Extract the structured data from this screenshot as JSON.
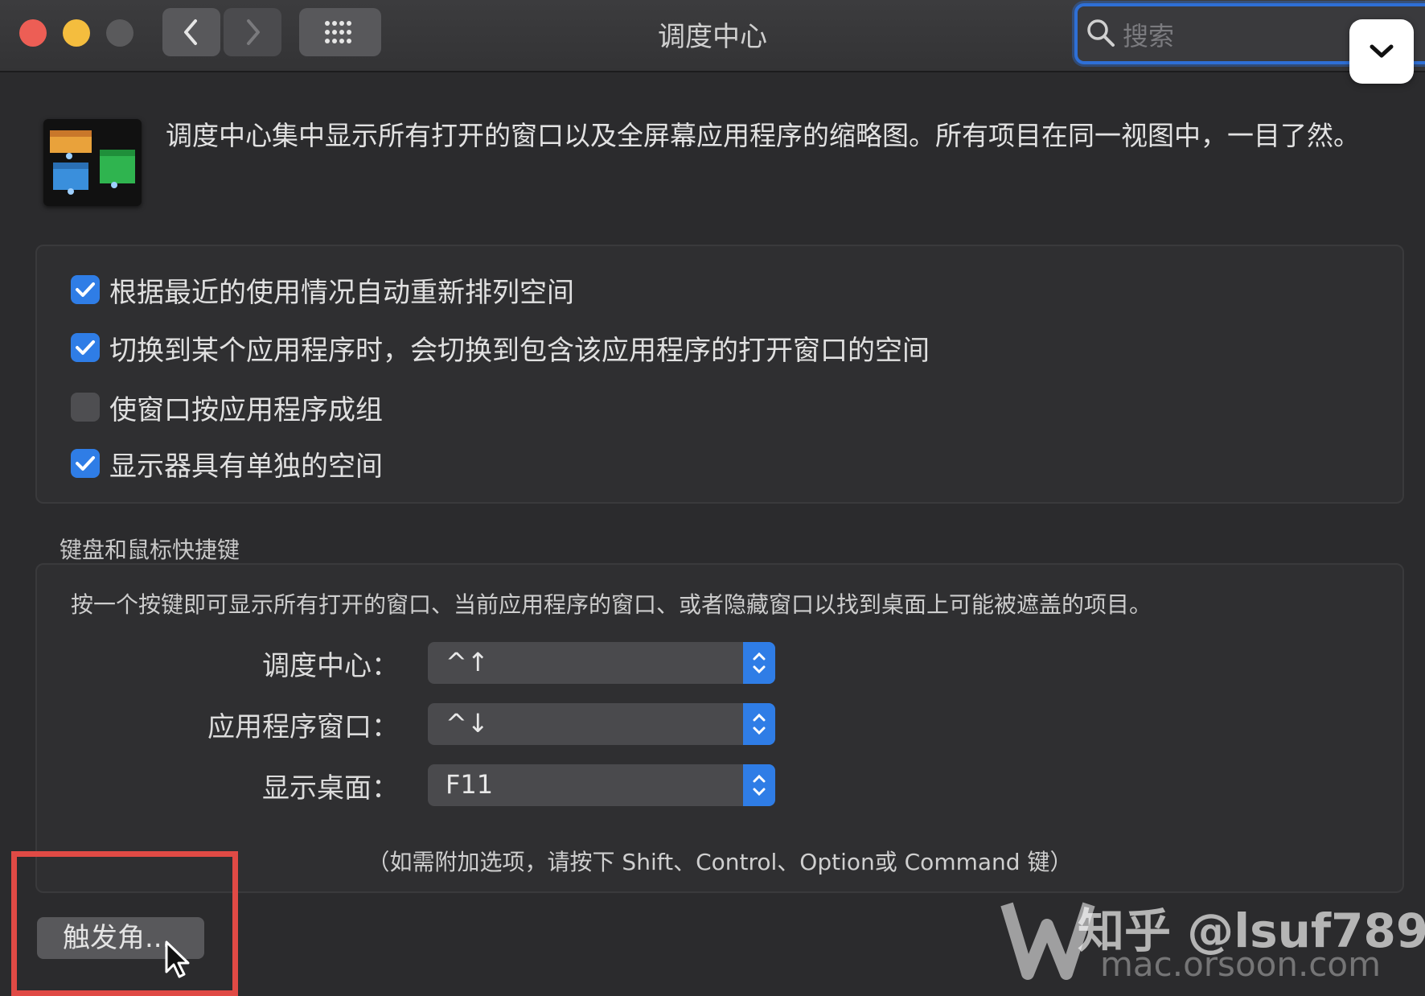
{
  "window": {
    "title": "调度中心",
    "search_placeholder": "搜索"
  },
  "intro": {
    "text": "调度中心集中显示所有打开的窗口以及全屏幕应用程序的缩略图。所有项目在同一视图中，一目了然。"
  },
  "options": [
    {
      "label": "根据最近的使用情况自动重新排列空间",
      "checked": true
    },
    {
      "label": "切换到某个应用程序时，会切换到包含该应用程序的打开窗口的空间",
      "checked": true
    },
    {
      "label": "使窗口按应用程序成组",
      "checked": false
    },
    {
      "label": "显示器具有单独的空间",
      "checked": true
    }
  ],
  "shortcuts": {
    "section_title": "键盘和鼠标快捷键",
    "description": "按一个按键即可显示所有打开的窗口、当前应用程序的窗口、或者隐藏窗口以找到桌面上可能被遮盖的项目。",
    "rows": [
      {
        "label": "调度中心：",
        "value": "^↑"
      },
      {
        "label": "应用程序窗口：",
        "value": "^↓"
      },
      {
        "label": "显示桌面：",
        "value": "F11"
      }
    ],
    "note": "（如需附加选项，请按下 Shift、Control、Option或 Command 键）"
  },
  "hot_corners_label": "触发角...",
  "watermark": {
    "line1": "知乎 @lsuf789",
    "line2": "mac.orsoon.com"
  },
  "colors": {
    "accent": "#2f7de6",
    "highlight_box": "#e04a45"
  }
}
